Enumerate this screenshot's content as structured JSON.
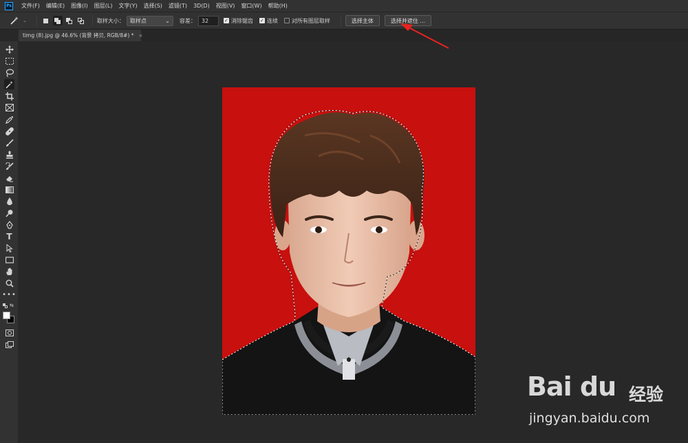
{
  "app": {
    "logo_text": "Ps"
  },
  "menubar": {
    "items": [
      "文件(F)",
      "编辑(E)",
      "图像(I)",
      "图层(L)",
      "文字(Y)",
      "选择(S)",
      "滤镜(T)",
      "3D(D)",
      "视图(V)",
      "窗口(W)",
      "帮助(H)"
    ]
  },
  "options": {
    "sample_size_label": "取样大小：",
    "sample_size_value": "取样点",
    "tolerance_label": "容差：",
    "tolerance_value": "32",
    "antialias_label": "消除锯齿",
    "antialias_checked": true,
    "contiguous_label": "连续",
    "contiguous_checked": true,
    "all_layers_label": "对所有图层取样",
    "all_layers_checked": false,
    "select_subject_label": "选择主体",
    "select_mask_label": "选择并遮住 ..."
  },
  "document": {
    "tab_title": "timg (8).jpg @ 46.6% (背景 拷贝, RGB/8#) *",
    "close_glyph": "×"
  },
  "colors": {
    "photo_background": "#c8100e",
    "foreground": "#ffffff",
    "background": "#000000",
    "annotation_arrow": "#e8231f"
  },
  "watermark": {
    "logo": "Bai du",
    "brand": "经验",
    "url": "jingyan.baidu.com"
  }
}
